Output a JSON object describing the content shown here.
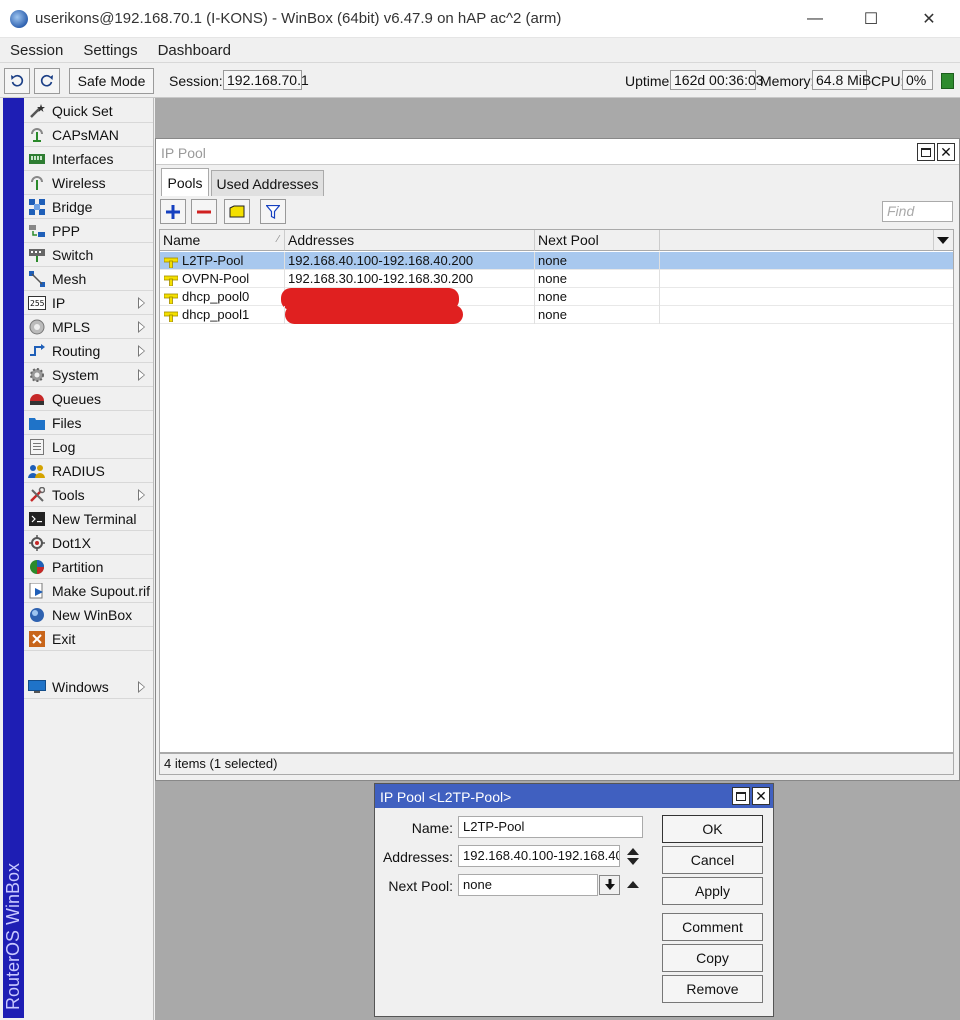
{
  "window": {
    "title": "userikons@192.168.70.1 (I-KONS) - WinBox (64bit) v6.47.9 on hAP ac^2 (arm)",
    "minimize": "—",
    "maximize": "☐",
    "close": "✕"
  },
  "menu": [
    "Session",
    "Settings",
    "Dashboard"
  ],
  "toolbar": {
    "undo_icon": "undo-icon",
    "redo_icon": "redo-icon",
    "safe_mode": "Safe Mode",
    "session_label": "Session:",
    "session_value": "192.168.70.1",
    "uptime_label": "Uptime:",
    "uptime_value": "162d 00:36:03",
    "memory_label": "Memory:",
    "memory_value": "64.8 MiB",
    "cpu_label": "CPU:",
    "cpu_value": "0%"
  },
  "sidebar": {
    "brand": "RouterOS WinBox",
    "items": [
      {
        "label": "Quick Set",
        "icon": "wand-icon",
        "submenu": false
      },
      {
        "label": "CAPsMAN",
        "icon": "antenna-icon",
        "submenu": false
      },
      {
        "label": "Interfaces",
        "icon": "interfaces-icon",
        "submenu": false
      },
      {
        "label": "Wireless",
        "icon": "wireless-icon",
        "submenu": false
      },
      {
        "label": "Bridge",
        "icon": "bridge-icon",
        "submenu": false
      },
      {
        "label": "PPP",
        "icon": "ppp-icon",
        "submenu": false
      },
      {
        "label": "Switch",
        "icon": "switch-icon",
        "submenu": false
      },
      {
        "label": "Mesh",
        "icon": "mesh-icon",
        "submenu": false
      },
      {
        "label": "IP",
        "icon": "ip-icon",
        "submenu": true
      },
      {
        "label": "MPLS",
        "icon": "mpls-icon",
        "submenu": true
      },
      {
        "label": "Routing",
        "icon": "routing-icon",
        "submenu": true
      },
      {
        "label": "System",
        "icon": "gear-icon",
        "submenu": true
      },
      {
        "label": "Queues",
        "icon": "queues-icon",
        "submenu": false
      },
      {
        "label": "Files",
        "icon": "folder-icon",
        "submenu": false
      },
      {
        "label": "Log",
        "icon": "log-icon",
        "submenu": false
      },
      {
        "label": "RADIUS",
        "icon": "users-icon",
        "submenu": false
      },
      {
        "label": "Tools",
        "icon": "tools-icon",
        "submenu": true
      },
      {
        "label": "New Terminal",
        "icon": "terminal-icon",
        "submenu": false
      },
      {
        "label": "Dot1X",
        "icon": "dot1x-icon",
        "submenu": false
      },
      {
        "label": "Partition",
        "icon": "pie-icon",
        "submenu": false
      },
      {
        "label": "Make Supout.rif",
        "icon": "supout-icon",
        "submenu": false
      },
      {
        "label": "New WinBox",
        "icon": "winbox-icon",
        "submenu": false
      },
      {
        "label": "Exit",
        "icon": "exit-icon",
        "submenu": false
      }
    ],
    "windows": {
      "label": "Windows",
      "icon": "monitor-icon",
      "submenu": true
    }
  },
  "pool_window": {
    "title": "IP Pool",
    "tabs": [
      "Pools",
      "Used Addresses"
    ],
    "find_placeholder": "Find",
    "columns": [
      "Name",
      "Addresses",
      "Next Pool"
    ],
    "rows": [
      {
        "name": "L2TP-Pool",
        "addresses": "192.168.40.100-192.168.40.200",
        "next_pool": "none",
        "selected": true
      },
      {
        "name": "OVPN-Pool",
        "addresses": "192.168.30.100-192.168.30.200",
        "next_pool": "none",
        "selected": false
      },
      {
        "name": "dhcp_pool0",
        "addresses": "",
        "next_pool": "none",
        "selected": false
      },
      {
        "name": "dhcp_pool1",
        "addresses": "",
        "next_pool": "none",
        "selected": false
      }
    ],
    "status": "4 items (1 selected)"
  },
  "edit_dialog": {
    "title": "IP Pool <L2TP-Pool>",
    "name_label": "Name:",
    "name_value": "L2TP-Pool",
    "addresses_label": "Addresses:",
    "addresses_value": "192.168.40.100-192.168.40.",
    "next_pool_label": "Next Pool:",
    "next_pool_value": "none",
    "buttons": {
      "ok": "OK",
      "cancel": "Cancel",
      "apply": "Apply",
      "comment": "Comment",
      "copy": "Copy",
      "remove": "Remove"
    }
  },
  "colors": {
    "sidebar_strip": "#1e1eb4",
    "selection": "#a8c8ee",
    "dialog_title": "#4060c0",
    "redaction": "#e02020"
  }
}
